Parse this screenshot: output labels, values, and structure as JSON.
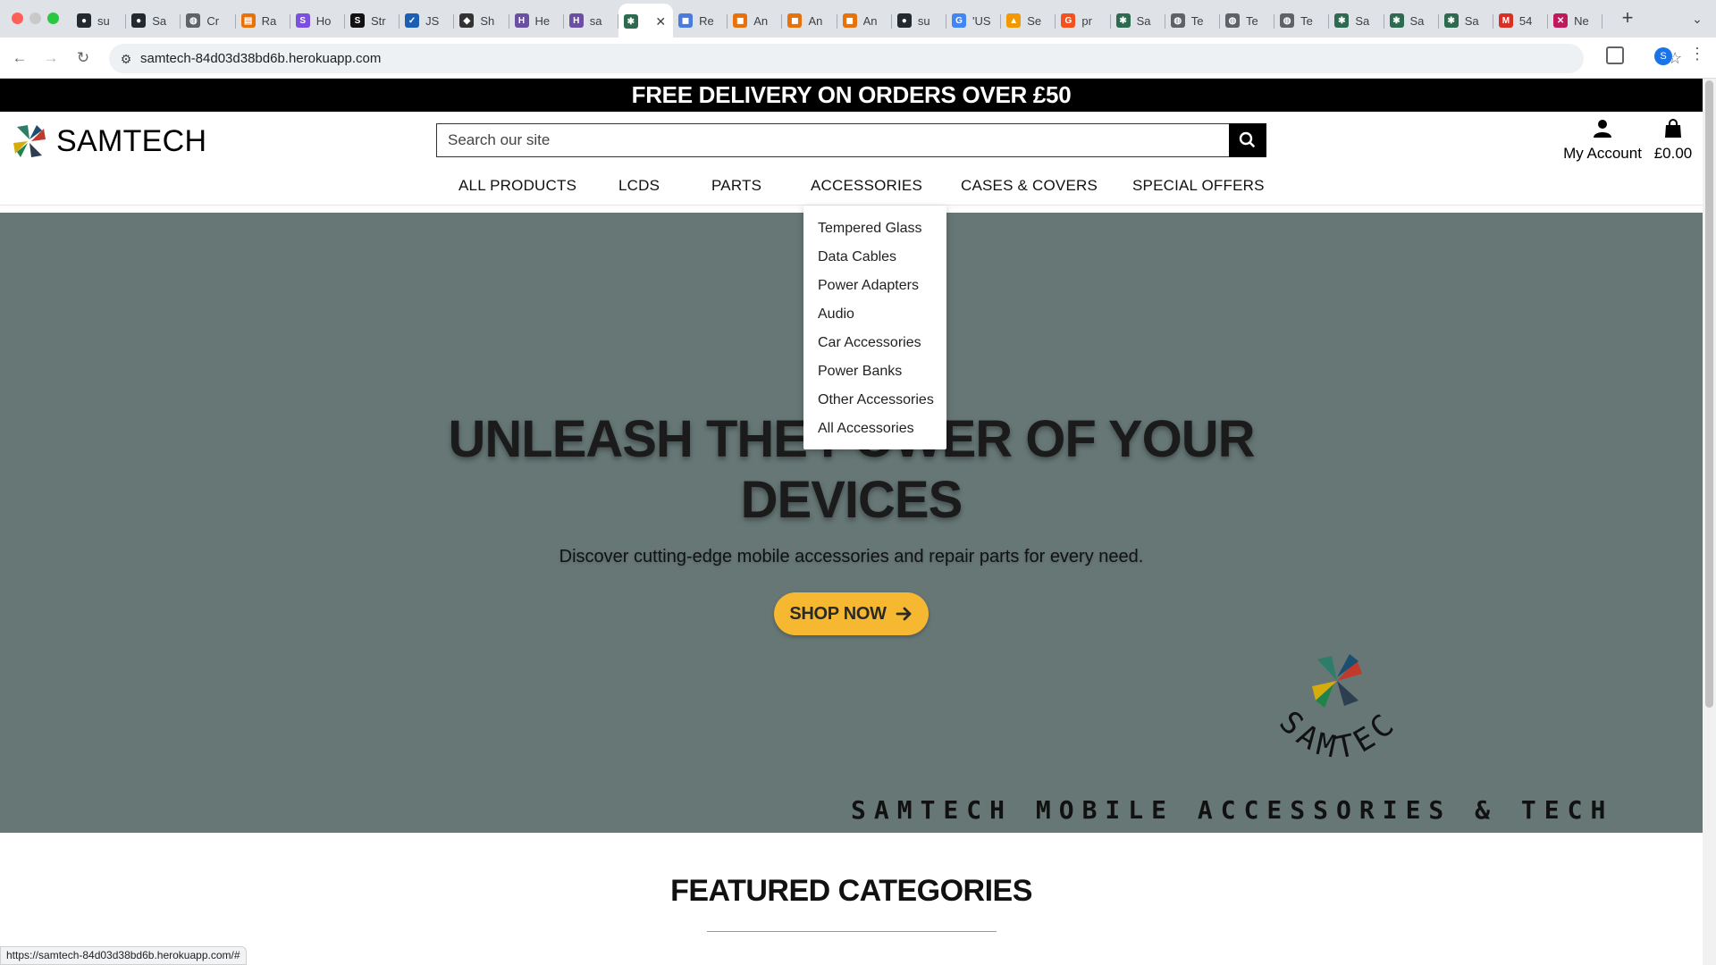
{
  "browser": {
    "tabs": [
      {
        "label": "su",
        "icon": "github-icon",
        "color": "#24292f"
      },
      {
        "label": "Sa",
        "icon": "github-icon",
        "color": "#24292f"
      },
      {
        "label": "Cr",
        "icon": "globe-icon",
        "color": "#5f6368"
      },
      {
        "label": "Ra",
        "icon": "rss-icon",
        "color": "#e8710a"
      },
      {
        "label": "Ho",
        "icon": "s-icon",
        "color": "#7b4fe0"
      },
      {
        "label": "Str",
        "icon": "s-icon",
        "color": "#111111"
      },
      {
        "label": "JS",
        "icon": "check-icon",
        "color": "#1a5fb4"
      },
      {
        "label": "Sh",
        "icon": "shield-icon",
        "color": "#333333"
      },
      {
        "label": "He",
        "icon": "h-icon",
        "color": "#6a4fa3"
      },
      {
        "label": "sa",
        "icon": "h-icon",
        "color": "#6a4fa3"
      },
      {
        "label": "",
        "icon": "samtech-icon",
        "color": "#2d6a4f",
        "active": true
      },
      {
        "label": "Re",
        "icon": "cube-icon",
        "color": "#4a7be0"
      },
      {
        "label": "An",
        "icon": "cube-icon",
        "color": "#e8710a"
      },
      {
        "label": "An",
        "icon": "cube-icon",
        "color": "#e8710a"
      },
      {
        "label": "An",
        "icon": "cube-icon",
        "color": "#e8710a"
      },
      {
        "label": "su",
        "icon": "github-icon",
        "color": "#24292f"
      },
      {
        "label": "'US",
        "icon": "google-icon",
        "color": "#4285f4"
      },
      {
        "label": "Se",
        "icon": "chart-icon",
        "color": "#f29900"
      },
      {
        "label": "pr",
        "icon": "g-icon",
        "color": "#f4511e"
      },
      {
        "label": "Sa",
        "icon": "samtech-icon",
        "color": "#2d6a4f"
      },
      {
        "label": "Te",
        "icon": "globe-icon",
        "color": "#5f6368"
      },
      {
        "label": "Te",
        "icon": "globe-icon",
        "color": "#5f6368"
      },
      {
        "label": "Te",
        "icon": "globe-icon",
        "color": "#5f6368"
      },
      {
        "label": "Sa",
        "icon": "samtech-icon",
        "color": "#2d6a4f"
      },
      {
        "label": "Sa",
        "icon": "samtech-icon",
        "color": "#2d6a4f"
      },
      {
        "label": "Sa",
        "icon": "samtech-icon",
        "color": "#2d6a4f"
      },
      {
        "label": "54",
        "icon": "gmail-icon",
        "color": "#d93025"
      },
      {
        "label": "Ne",
        "icon": "x-icon",
        "color": "#c2185b"
      }
    ],
    "url": "samtech-84d03d38bd6b.herokuapp.com",
    "status_url": "https://samtech-84d03d38bd6b.herokuapp.com/#",
    "profile_initial": "S"
  },
  "promo": {
    "text": "FREE DELIVERY ON ORDERS OVER £50"
  },
  "header": {
    "logo_text": "SAMTECH",
    "search_placeholder": "Search our site",
    "account_label": "My Account",
    "bag_total": "£0.00"
  },
  "nav": {
    "items": [
      "ALL PRODUCTS",
      "LCDS",
      "PARTS",
      "ACCESSORIES",
      "CASES & COVERS",
      "SPECIAL OFFERS"
    ],
    "open_menu": "ACCESSORIES"
  },
  "dropdown": {
    "items": [
      "Tempered Glass",
      "Data Cables",
      "Power Adapters",
      "Audio",
      "Car Accessories",
      "Power Banks",
      "Other Accessories",
      "All Accessories"
    ]
  },
  "hero": {
    "title_line1": "UNLEASH THE POWER OF YOUR",
    "title_line2": "DEVICES",
    "subtitle": "Discover cutting-edge mobile accessories and repair parts for every need.",
    "cta_label": "SHOP NOW",
    "brand_banner": "SAMTECH MOBILE ACCESSORIES & TECH",
    "logo_arc_text": "SAMTECH",
    "background": "#667776",
    "cta_color": "#f6b731"
  },
  "featured": {
    "title": "FEATURED CATEGORIES"
  }
}
